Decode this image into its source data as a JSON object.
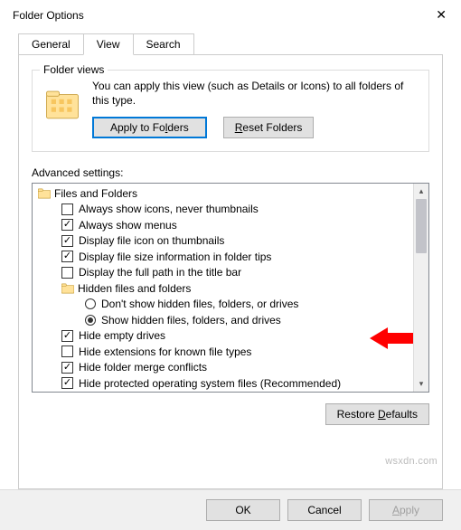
{
  "window": {
    "title": "Folder Options"
  },
  "tabs": {
    "general": "General",
    "view": "View",
    "search": "Search",
    "active": "view"
  },
  "folder_views": {
    "group_label": "Folder views",
    "description": "You can apply this view (such as Details or Icons) to all folders of this type.",
    "apply_btn_pre": "Apply to Fo",
    "apply_btn_u": "l",
    "apply_btn_post": "ders",
    "reset_btn_u": "R",
    "reset_btn_post": "eset Folders"
  },
  "advanced": {
    "label": "Advanced settings:",
    "items": [
      {
        "type": "folder",
        "indent": 1,
        "label": "Files and Folders"
      },
      {
        "type": "check",
        "indent": 2,
        "checked": false,
        "label": "Always show icons, never thumbnails"
      },
      {
        "type": "check",
        "indent": 2,
        "checked": true,
        "label": "Always show menus"
      },
      {
        "type": "check",
        "indent": 2,
        "checked": true,
        "label": "Display file icon on thumbnails"
      },
      {
        "type": "check",
        "indent": 2,
        "checked": true,
        "label": "Display file size information in folder tips"
      },
      {
        "type": "check",
        "indent": 2,
        "checked": false,
        "label": "Display the full path in the title bar"
      },
      {
        "type": "folder",
        "indent": 2,
        "label": "Hidden files and folders"
      },
      {
        "type": "radio",
        "indent": 3,
        "checked": false,
        "label": "Don't show hidden files, folders, or drives"
      },
      {
        "type": "radio",
        "indent": 3,
        "checked": true,
        "label": "Show hidden files, folders, and drives"
      },
      {
        "type": "check",
        "indent": 2,
        "checked": true,
        "label": "Hide empty drives"
      },
      {
        "type": "check",
        "indent": 2,
        "checked": false,
        "label": "Hide extensions for known file types"
      },
      {
        "type": "check",
        "indent": 2,
        "checked": true,
        "label": "Hide folder merge conflicts"
      },
      {
        "type": "check",
        "indent": 2,
        "checked": true,
        "label": "Hide protected operating system files (Recommended)"
      }
    ],
    "restore_pre": "Restore ",
    "restore_u": "D",
    "restore_post": "efaults"
  },
  "buttons": {
    "ok": "OK",
    "cancel": "Cancel",
    "apply_u": "A",
    "apply_post": "pply"
  },
  "watermark": "wsxdn.com"
}
